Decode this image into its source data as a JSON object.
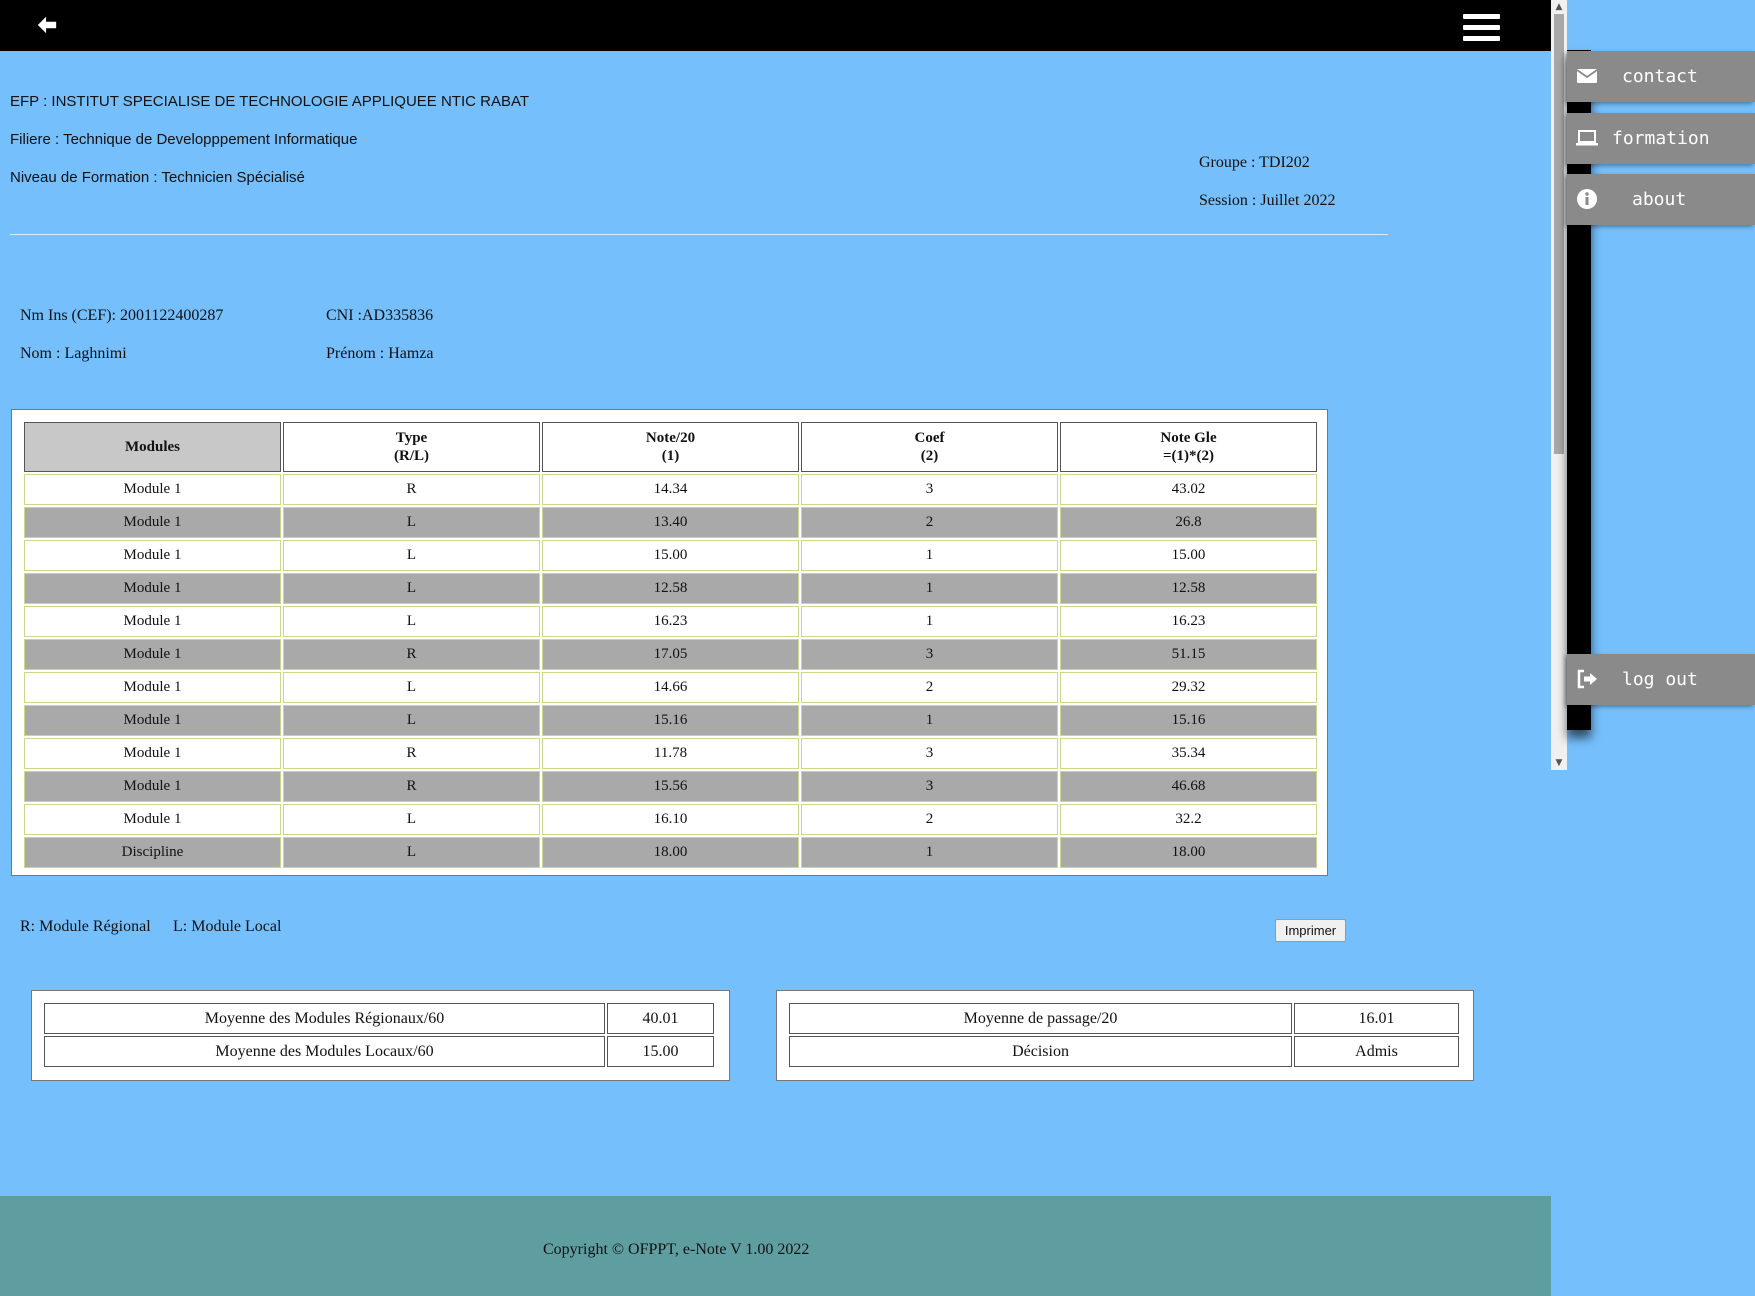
{
  "header": {
    "back_icon": "arrow-left-icon",
    "menu_icon": "hamburger-menu-icon"
  },
  "sidebar": {
    "items": [
      {
        "label": "contact",
        "icon": "envelope-icon"
      },
      {
        "label": "formation",
        "icon": "laptop-icon"
      },
      {
        "label": "about",
        "icon": "info-circle-icon"
      },
      {
        "label": "log out",
        "icon": "sign-out-icon"
      }
    ]
  },
  "school": {
    "efp": "EFP : INSTITUT SPECIALISE DE TECHNOLOGIE APPLIQUEE NTIC RABAT",
    "filiere": "Filiere : Technique de Developppement Informatique",
    "niveau": "Niveau de Formation : Technicien Spécialisé",
    "groupe": "Groupe : TDI202",
    "session": "Session : Juillet 2022"
  },
  "student": {
    "cef": "Nm Ins (CEF): 2001122400287",
    "cni": "CNI :AD335836",
    "nom": "Nom : Laghnimi",
    "prenom": "Prénom : Hamza"
  },
  "table": {
    "headers": [
      {
        "line1": "Modules",
        "line2": ""
      },
      {
        "line1": "Type",
        "line2": "(R/L)"
      },
      {
        "line1": "Note/20",
        "line2": "(1)"
      },
      {
        "line1": "Coef",
        "line2": "(2)"
      },
      {
        "line1": "Note Gle",
        "line2": "=(1)*(2)"
      }
    ],
    "rows": [
      [
        "Module 1",
        "R",
        "14.34",
        "3",
        "43.02"
      ],
      [
        "Module 1",
        "L",
        "13.40",
        "2",
        "26.8"
      ],
      [
        "Module 1",
        "L",
        "15.00",
        "1",
        "15.00"
      ],
      [
        "Module 1",
        "L",
        "12.58",
        "1",
        "12.58"
      ],
      [
        "Module 1",
        "L",
        "16.23",
        "1",
        "16.23"
      ],
      [
        "Module 1",
        "R",
        "17.05",
        "3",
        "51.15"
      ],
      [
        "Module 1",
        "L",
        "14.66",
        "2",
        "29.32"
      ],
      [
        "Module 1",
        "L",
        "15.16",
        "1",
        "15.16"
      ],
      [
        "Module 1",
        "R",
        "11.78",
        "3",
        "35.34"
      ],
      [
        "Module 1",
        "R",
        "15.56",
        "3",
        "46.68"
      ],
      [
        "Module 1",
        "L",
        "16.10",
        "2",
        "32.2"
      ],
      [
        "Discipline",
        "L",
        "18.00",
        "1",
        "18.00"
      ]
    ]
  },
  "legend": {
    "regional": "R: Module Régional",
    "local": "L: Module Local"
  },
  "print_label": "Imprimer",
  "summary_left": {
    "rows": [
      {
        "label": "Moyenne des Modules Régionaux/60",
        "value": "40.01"
      },
      {
        "label": "Moyenne des Modules Locaux/60",
        "value": "15.00"
      }
    ]
  },
  "summary_right": {
    "rows": [
      {
        "label": "Moyenne de passage/20",
        "value": "16.01"
      },
      {
        "label": "Décision",
        "value": "Admis"
      }
    ]
  },
  "footer": {
    "copyright": "Copyright © OFPPT, e-Note V 1.00 2022"
  }
}
